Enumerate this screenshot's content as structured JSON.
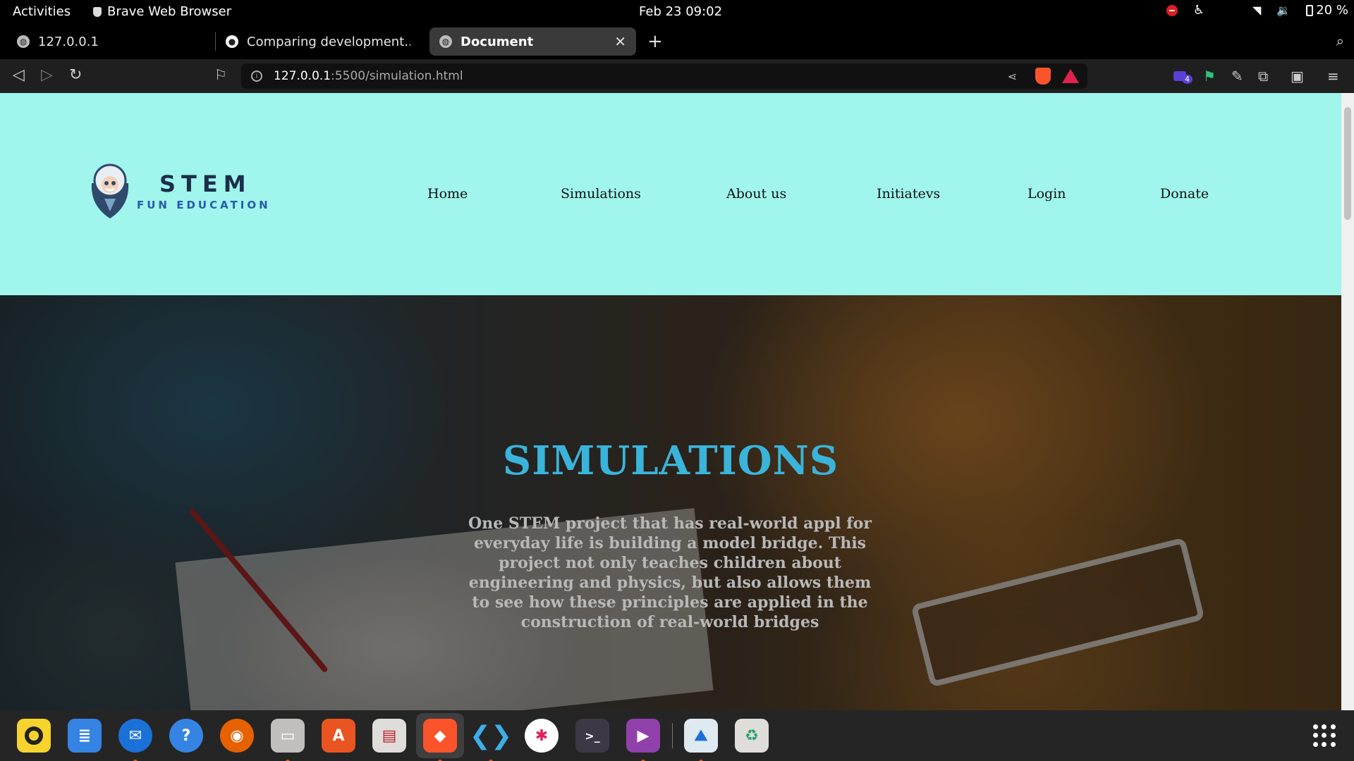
{
  "system_bar": {
    "activities": "Activities",
    "app_name": "Brave Web Browser",
    "clock": "Feb 23  09:02",
    "battery": "20 %"
  },
  "browser": {
    "tabs": [
      {
        "title": "127.0.0.1",
        "active": false
      },
      {
        "title": "Comparing development...de",
        "active": false
      },
      {
        "title": "Document",
        "active": true
      }
    ],
    "url_host": "127.0.0.1",
    "url_path": ":5500/simulation.html",
    "extension_badge": "4"
  },
  "site": {
    "logo": {
      "title": "STEM",
      "subtitle": "FUN EDUCATION"
    },
    "nav": [
      "Home",
      "Simulations",
      "About us",
      "Initiatevs",
      "Login",
      "Donate"
    ],
    "hero": {
      "heading": "SIMULATIONS",
      "body": "One STEM project that has real-world appl for everyday life is building a model bridge. This project not only teaches children about engineering and physics, but also allows them to see how these principles are applied in the construction of real-world bridges"
    },
    "colors": {
      "header_bg": "#a0f5ec",
      "heading": "#3ab4da",
      "body_text": "#b8b8b8"
    }
  },
  "dock": {
    "apps": [
      "rhythmbox-icon",
      "text-editor-icon",
      "thunderbird-icon",
      "help-icon",
      "firefox-icon",
      "files-icon",
      "app-center-icon",
      "document-viewer-icon",
      "brave-icon",
      "vscode-icon",
      "slack-icon",
      "terminal-icon",
      "video-player-icon",
      "screenshot-icon",
      "trash-icon"
    ]
  }
}
